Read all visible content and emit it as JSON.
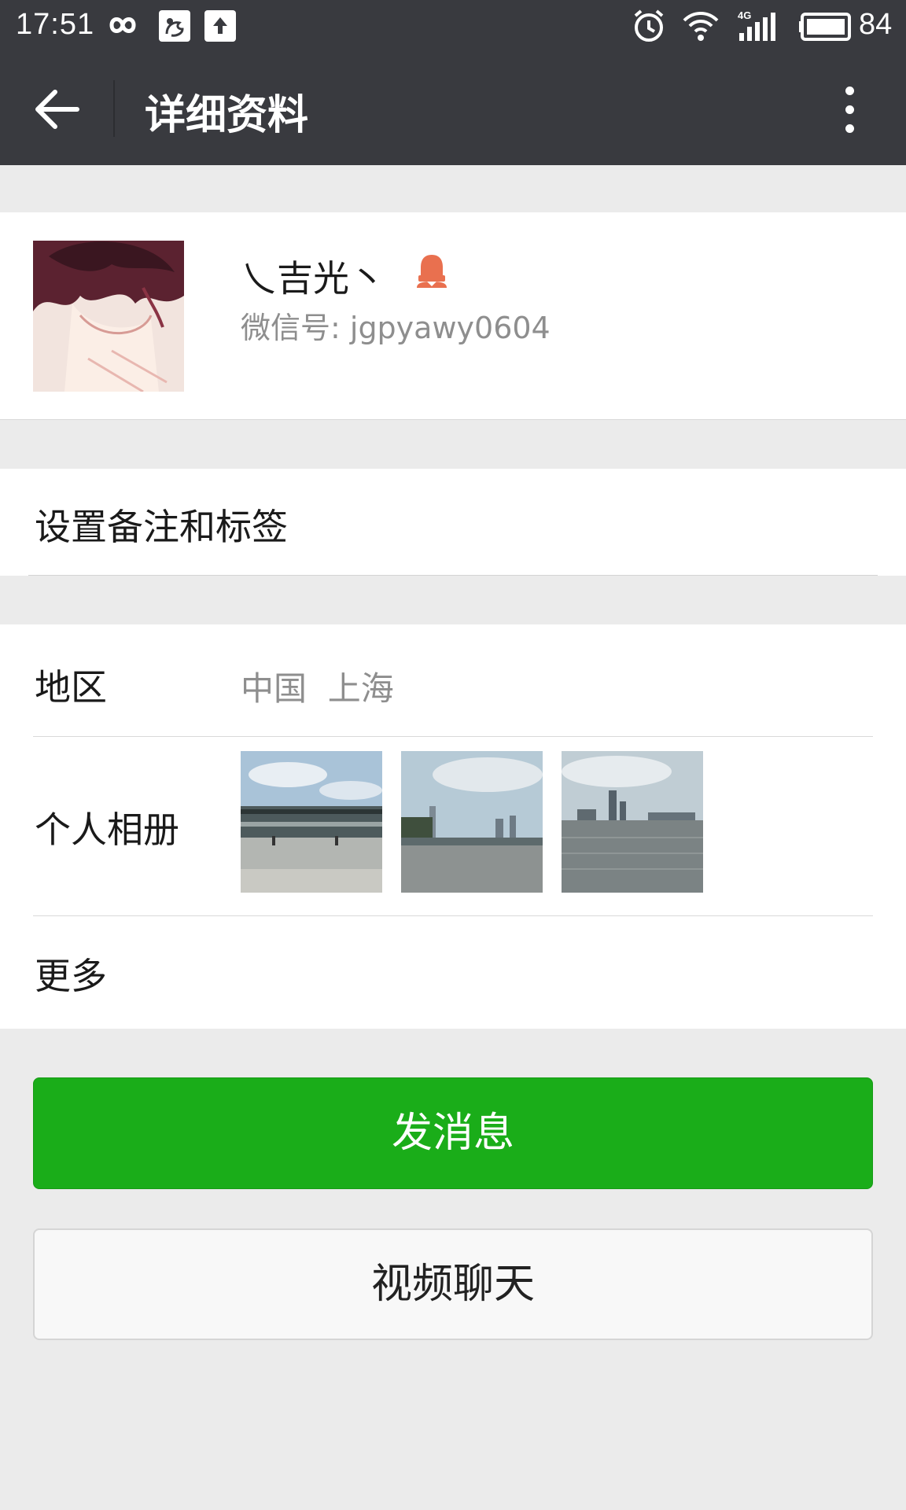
{
  "status_bar": {
    "time": "17:51",
    "battery_level": "84",
    "network_type": "4G",
    "icons": [
      "infinity-icon",
      "uc-browser-icon",
      "upload-icon",
      "alarm-icon",
      "wifi-icon",
      "signal-icon",
      "battery-icon"
    ]
  },
  "toolbar": {
    "title": "详细资料",
    "back_icon": "arrow-left-icon",
    "more_icon": "more-vertical-icon"
  },
  "profile": {
    "nickname": "乀吉光丶",
    "gender_icon": "female-icon",
    "wechat_id": "微信号: jgpyawy0604"
  },
  "remark": {
    "label": "设置备注和标签"
  },
  "info": {
    "region_label": "地区",
    "region_value": "中国  上海",
    "album_label": "个人相册",
    "more_label": "更多"
  },
  "actions": {
    "send_message": "发消息",
    "video_chat": "视频聊天"
  },
  "colors": {
    "header_bg": "#393a3f",
    "page_bg": "#ebebeb",
    "primary_green": "#1aad19",
    "gender_female": "#e9704f"
  }
}
